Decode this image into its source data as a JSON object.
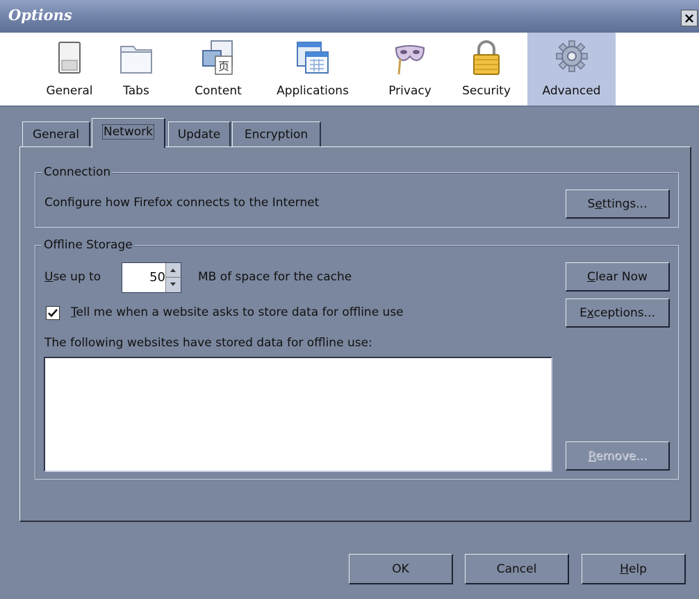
{
  "window": {
    "title": "Options",
    "close_glyph": "×"
  },
  "toolbar": {
    "items": [
      {
        "label": "General",
        "icon": "general-switch-icon"
      },
      {
        "label": "Tabs",
        "icon": "tabs-folder-icon"
      },
      {
        "label": "Content",
        "icon": "content-page-icon"
      },
      {
        "label": "Applications",
        "icon": "applications-window-icon"
      },
      {
        "label": "Privacy",
        "icon": "privacy-mask-icon"
      },
      {
        "label": "Security",
        "icon": "security-lock-icon"
      },
      {
        "label": "Advanced",
        "icon": "advanced-gear-icon",
        "selected": true
      }
    ]
  },
  "tabs": {
    "items": [
      "General",
      "Network",
      "Update",
      "Encryption"
    ],
    "active": "Network"
  },
  "connection": {
    "legend": "Connection",
    "description": "Configure how Firefox connects to the Internet",
    "settings_pre": "S",
    "settings_u": "e",
    "settings_post": "ttings..."
  },
  "offline": {
    "legend": "Offline Storage",
    "use_up_u": "U",
    "use_up_post": "se up to",
    "cache_value": "50",
    "cache_suffix": "MB of space for the cache",
    "clear_u": "C",
    "clear_post": "lear Now",
    "exceptions_pre": "E",
    "exceptions_u": "x",
    "exceptions_post": "ceptions...",
    "tell_me_checked": true,
    "tell_me_u": "T",
    "tell_me_post": "ell me when a website asks to store data for offline use",
    "list_label": "The following websites have stored data for offline use:",
    "remove_u": "R",
    "remove_post": "emove..."
  },
  "footer": {
    "ok": "OK",
    "cancel": "Cancel",
    "help_u": "H",
    "help_post": "elp"
  }
}
